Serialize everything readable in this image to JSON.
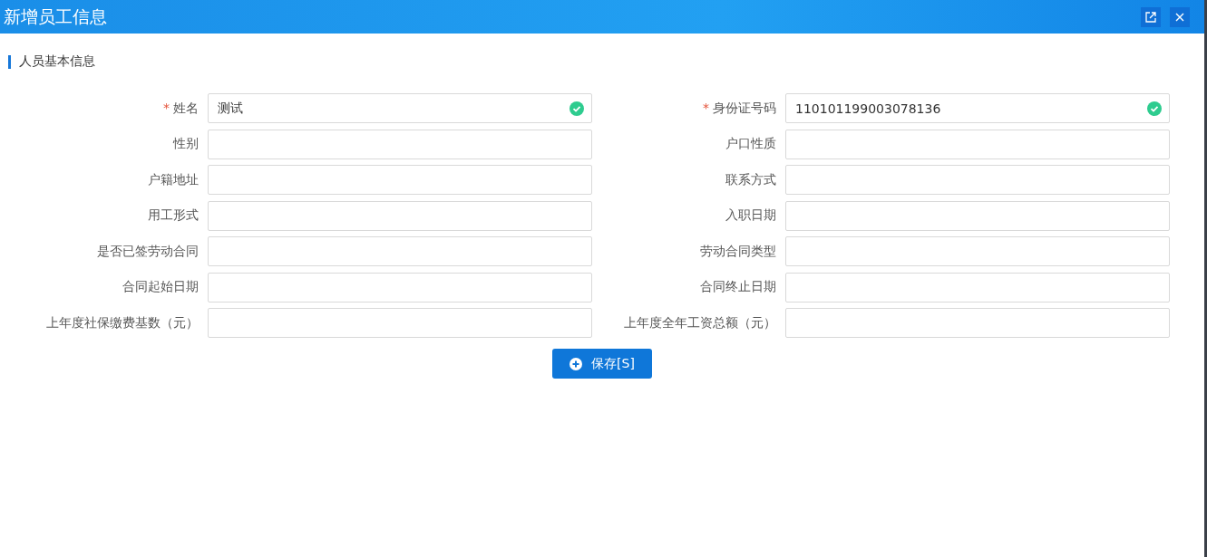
{
  "window": {
    "title": "新增员工信息"
  },
  "section": {
    "title": "人员基本信息"
  },
  "fields": [
    {
      "label": "姓名",
      "mark": "*",
      "value": "测试",
      "valid": true
    },
    {
      "label": "身份证号码",
      "mark": "*",
      "value": "110101199003078136",
      "valid": true
    },
    {
      "label": "性别",
      "valid": false
    },
    {
      "label": "户口性质",
      "valid": false
    },
    {
      "label": "户籍地址",
      "valid": false
    },
    {
      "label": "联系方式",
      "valid": false
    },
    {
      "label": "用工形式",
      "valid": false
    },
    {
      "label": "入职日期",
      "valid": false
    },
    {
      "label": "是否已签劳动合同",
      "valid": false
    },
    {
      "label": "劳动合同类型",
      "valid": false
    },
    {
      "label": "合同起始日期",
      "valid": false
    },
    {
      "label": "合同终止日期",
      "valid": false
    },
    {
      "label": "上年度社保缴费基数（元）",
      "valid": false
    },
    {
      "label": "上年度全年工资总额（元）",
      "valid": false
    }
  ],
  "save_button": {
    "label": "保存[S]"
  }
}
